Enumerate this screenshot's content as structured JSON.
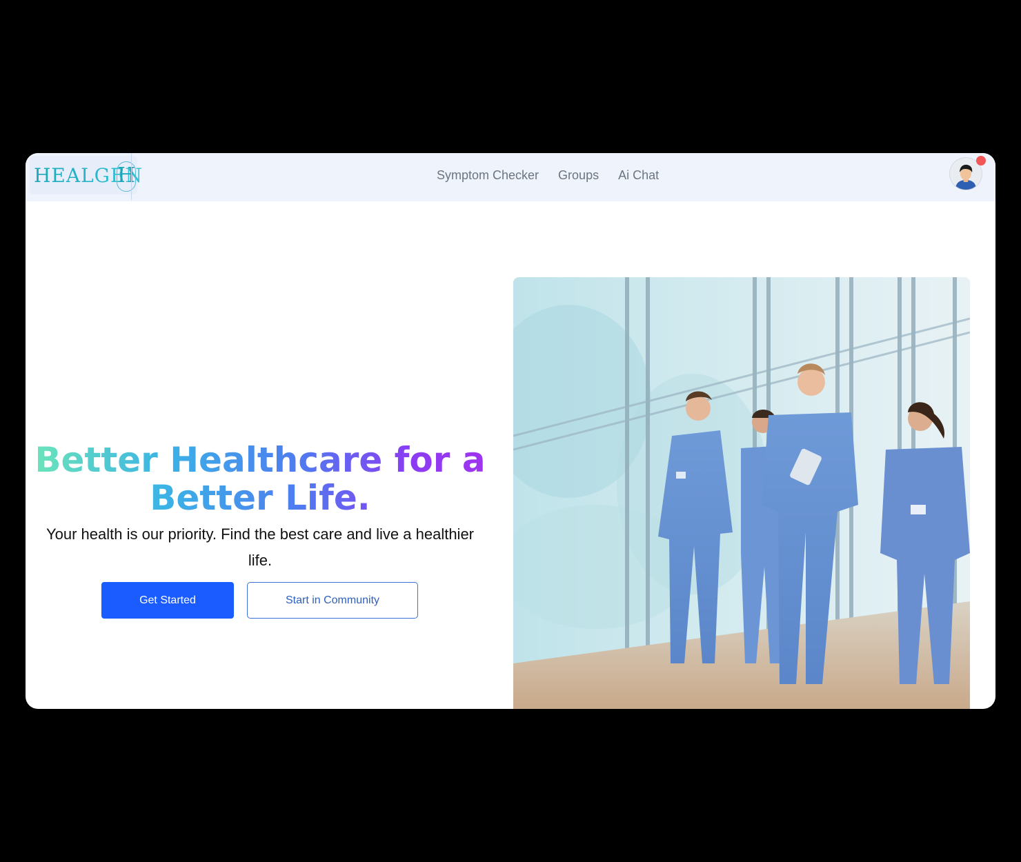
{
  "brand": {
    "logo_text": "HEALGEN",
    "logo_mark": "H"
  },
  "nav": {
    "links": [
      {
        "label": "Symptom Checker"
      },
      {
        "label": "Groups"
      },
      {
        "label": "Ai Chat"
      }
    ]
  },
  "user": {
    "avatar_icon": "user-avatar-icon",
    "has_notification": true,
    "notification_color": "#f25757"
  },
  "hero": {
    "title": "Better Healthcare for a Better Life.",
    "subtitle": "Your health is our priority. Find the best care and live a healthier life.",
    "primary_button": "Get Started",
    "secondary_button": "Start in Community"
  },
  "colors": {
    "primary": "#1a5cff",
    "nav_bg": "#eef3fc",
    "title_gradient": [
      "#6ee7b7",
      "#3bb2e6",
      "#4f7cf0",
      "#8a3df2",
      "#a332f0"
    ]
  }
}
